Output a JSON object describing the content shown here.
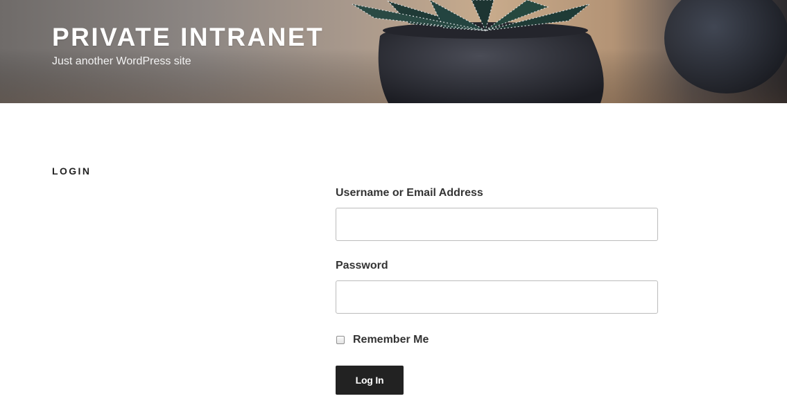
{
  "header": {
    "site_title": "PRIVATE INTRANET",
    "site_description": "Just another WordPress site"
  },
  "main": {
    "page_title": "LOGIN"
  },
  "login_form": {
    "username_label": "Username or Email Address",
    "username_value": "",
    "password_label": "Password",
    "password_value": "",
    "remember_label": "Remember Me",
    "remember_checked": false,
    "submit_label": "Log In"
  },
  "colors": {
    "button_background": "#222222",
    "button_text": "#ffffff",
    "header_title": "#ffffff",
    "body_text": "#222222"
  },
  "icons": {
    "header_image": "succulent-plant-in-dark-pot-photo"
  }
}
